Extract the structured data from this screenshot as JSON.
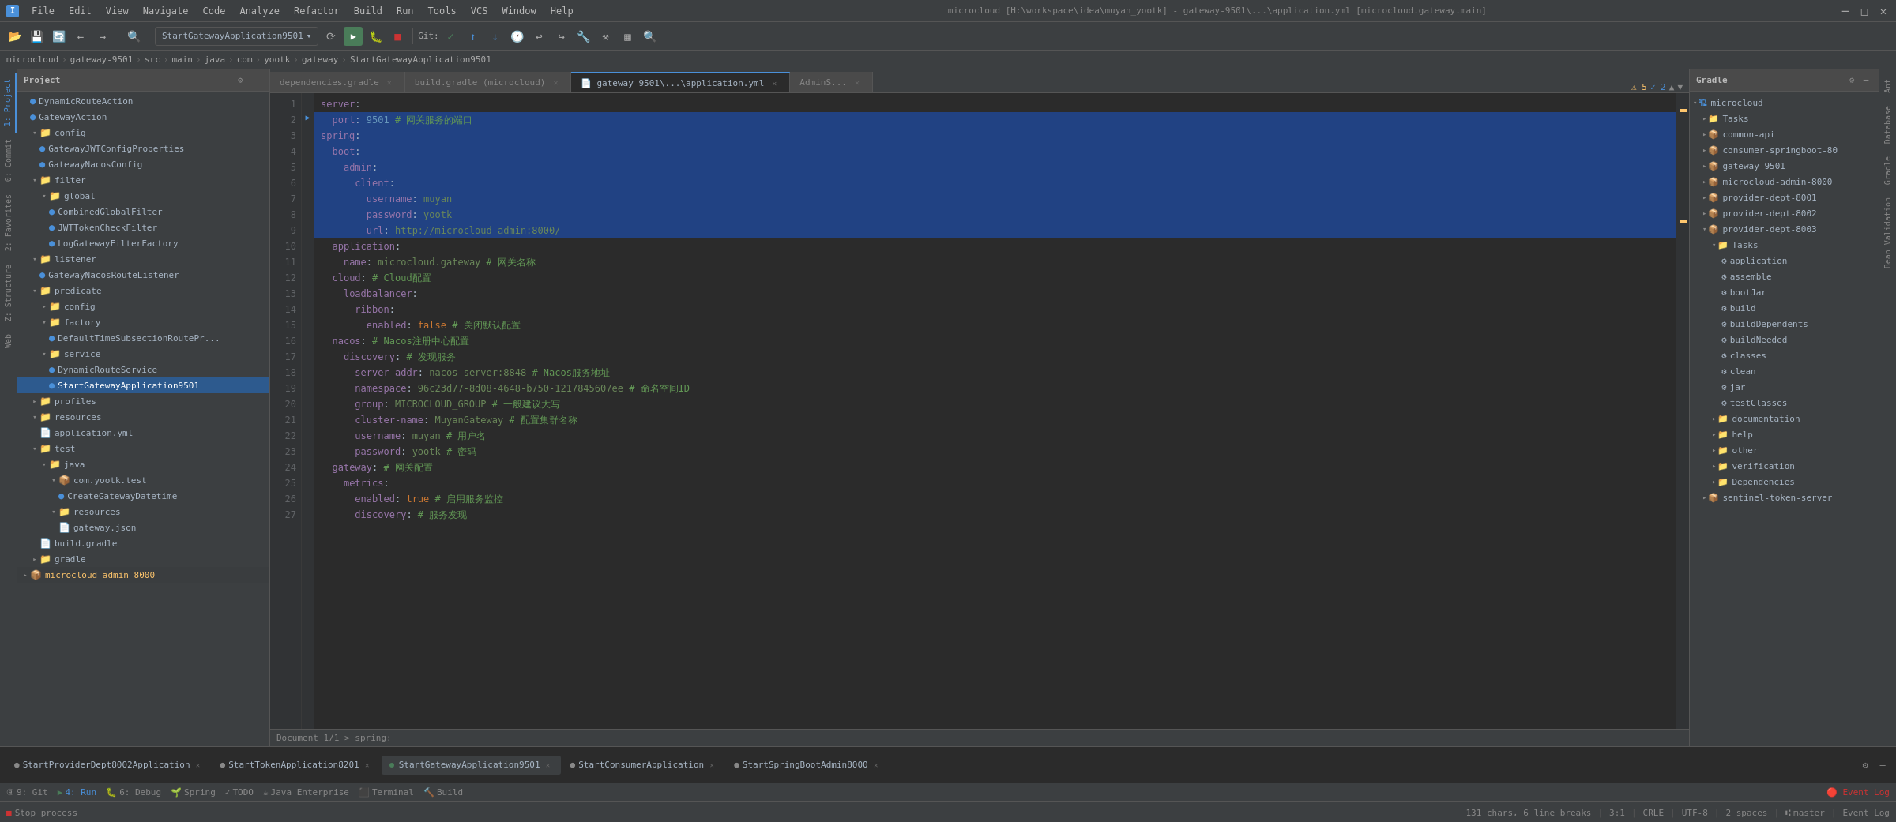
{
  "titleBar": {
    "title": "microcloud [H:\\workspace\\idea\\muyan_yootk] - gateway-9501\\...\\application.yml [microcloud.gateway.main]",
    "menus": [
      "File",
      "Edit",
      "View",
      "Navigate",
      "Code",
      "Analyze",
      "Refactor",
      "Build",
      "Run",
      "Tools",
      "VCS",
      "Window",
      "Help"
    ]
  },
  "toolbar": {
    "runConfig": "StartGatewayApplication9501",
    "gitLabel": "Git:"
  },
  "breadcrumb": {
    "items": [
      "microcloud",
      "gateway-9501",
      "src",
      "main",
      "java",
      "com",
      "yootk",
      "gateway",
      "StartGatewayApplication9501"
    ]
  },
  "editorTabs": [
    {
      "label": "dependencies.gradle",
      "active": false,
      "modified": false
    },
    {
      "label": "build.gradle (microcloud)",
      "active": false,
      "modified": false
    },
    {
      "label": "gateway-9501\\...\\application.yml",
      "active": true,
      "modified": false
    },
    {
      "label": "AdminS...",
      "active": false,
      "modified": false
    }
  ],
  "projectPanel": {
    "title": "Project",
    "items": [
      {
        "indent": 0,
        "type": "class",
        "label": "DynamicRouteAction",
        "color": "blue"
      },
      {
        "indent": 0,
        "type": "class",
        "label": "GatewayAction",
        "color": "blue"
      },
      {
        "indent": 0,
        "type": "folder",
        "label": "config",
        "expanded": true
      },
      {
        "indent": 1,
        "type": "class",
        "label": "GatewayJWTConfigProperties",
        "color": "blue"
      },
      {
        "indent": 1,
        "type": "class",
        "label": "GatewayNacosConfig",
        "color": "blue"
      },
      {
        "indent": 0,
        "type": "folder",
        "label": "filter",
        "expanded": true
      },
      {
        "indent": 1,
        "type": "folder",
        "label": "global",
        "expanded": true
      },
      {
        "indent": 2,
        "type": "class",
        "label": "CombinedGlobalFilter",
        "color": "blue"
      },
      {
        "indent": 2,
        "type": "class",
        "label": "JWTTokenCheckFilter",
        "color": "blue"
      },
      {
        "indent": 2,
        "type": "class",
        "label": "LogGatewayFilterFactory",
        "color": "blue"
      },
      {
        "indent": 0,
        "type": "folder",
        "label": "listener",
        "expanded": true
      },
      {
        "indent": 1,
        "type": "class",
        "label": "GatewayNacosRouteListener",
        "color": "blue"
      },
      {
        "indent": 0,
        "type": "folder",
        "label": "predicate",
        "expanded": true
      },
      {
        "indent": 1,
        "type": "folder",
        "label": "config",
        "expanded": false
      },
      {
        "indent": 1,
        "type": "folder",
        "label": "factory",
        "expanded": true
      },
      {
        "indent": 2,
        "type": "class",
        "label": "DefaultTimeSubsectionRoutePr...",
        "color": "blue"
      },
      {
        "indent": 1,
        "type": "folder",
        "label": "service",
        "expanded": true
      },
      {
        "indent": 2,
        "type": "class",
        "label": "DynamicRouteService",
        "color": "blue"
      },
      {
        "indent": 2,
        "type": "class",
        "label": "StartGatewayApplication9501",
        "color": "blue",
        "selected": true
      },
      {
        "indent": 0,
        "type": "folder",
        "label": "profiles",
        "expanded": false
      },
      {
        "indent": 0,
        "type": "folder",
        "label": "resources",
        "expanded": true
      },
      {
        "indent": 1,
        "type": "file",
        "label": "application.yml",
        "color": "yellow"
      },
      {
        "indent": 0,
        "type": "folder",
        "label": "test",
        "expanded": true
      },
      {
        "indent": 1,
        "type": "folder",
        "label": "java",
        "expanded": true
      },
      {
        "indent": 2,
        "type": "package",
        "label": "com.yootk.test",
        "expanded": true
      },
      {
        "indent": 3,
        "type": "class",
        "label": "CreateGatewayDatetime",
        "color": "blue"
      },
      {
        "indent": 2,
        "type": "folder",
        "label": "resources",
        "expanded": true
      },
      {
        "indent": 3,
        "type": "file",
        "label": "gateway.json",
        "color": "yellow"
      },
      {
        "indent": 1,
        "type": "file",
        "label": "build.gradle",
        "color": "green"
      },
      {
        "indent": 0,
        "type": "folder",
        "label": "gradle",
        "expanded": false
      },
      {
        "indent": 0,
        "type": "module",
        "label": "microcloud-admin-8000",
        "expanded": false
      }
    ]
  },
  "codeLines": [
    {
      "num": 1,
      "content": "server:",
      "highlight": false
    },
    {
      "num": 2,
      "content": "  port: 9501 # 网关服务的端口",
      "highlight": true
    },
    {
      "num": 3,
      "content": "spring:",
      "highlight": true
    },
    {
      "num": 4,
      "content": "  boot:",
      "highlight": true
    },
    {
      "num": 5,
      "content": "    admin:",
      "highlight": true
    },
    {
      "num": 6,
      "content": "      client:",
      "highlight": true
    },
    {
      "num": 7,
      "content": "        username: muyan",
      "highlight": true
    },
    {
      "num": 8,
      "content": "        password: yootk",
      "highlight": true
    },
    {
      "num": 9,
      "content": "        url: http://microcloud-admin:8000/",
      "highlight": true
    },
    {
      "num": 10,
      "content": "  application:",
      "highlight": false
    },
    {
      "num": 11,
      "content": "    name: microcloud.gateway # 网关名称",
      "highlight": false
    },
    {
      "num": 12,
      "content": "  cloud: # Cloud配置",
      "highlight": false
    },
    {
      "num": 13,
      "content": "    loadbalancer:",
      "highlight": false
    },
    {
      "num": 14,
      "content": "      ribbon:",
      "highlight": false
    },
    {
      "num": 15,
      "content": "        enabled: false # 关闭默认配置",
      "highlight": false
    },
    {
      "num": 16,
      "content": "  nacos: # Nacos注册中心配置",
      "highlight": false
    },
    {
      "num": 17,
      "content": "    discovery: # 发现服务",
      "highlight": false
    },
    {
      "num": 18,
      "content": "      server-addr: nacos-server:8848 # Nacos服务地址",
      "highlight": false
    },
    {
      "num": 19,
      "content": "      namespace: 96c23d77-8d08-4648-b750-1217845607ee # 命名空间ID",
      "highlight": false
    },
    {
      "num": 20,
      "content": "      group: MICROCLOUD_GROUP # 一般建议大写",
      "highlight": false
    },
    {
      "num": 21,
      "content": "      cluster-name: MuyanGateway # 配置集群名称",
      "highlight": false
    },
    {
      "num": 22,
      "content": "      username: muyan # 用户名",
      "highlight": false
    },
    {
      "num": 23,
      "content": "      password: yootk # 密码",
      "highlight": false
    },
    {
      "num": 24,
      "content": "  gateway: # 网关配置",
      "highlight": false
    },
    {
      "num": 25,
      "content": "    metrics:",
      "highlight": false
    },
    {
      "num": 26,
      "content": "      enabled: true # 启用服务监控",
      "highlight": false
    },
    {
      "num": 27,
      "content": "      discovery: # 服务发现",
      "highlight": false
    }
  ],
  "gradlePanel": {
    "title": "Gradle",
    "items": [
      {
        "indent": 0,
        "type": "project",
        "label": "microcloud",
        "expanded": true
      },
      {
        "indent": 1,
        "type": "folder",
        "label": "Tasks",
        "expanded": false
      },
      {
        "indent": 1,
        "type": "module",
        "label": "common-api",
        "expanded": false
      },
      {
        "indent": 1,
        "type": "module",
        "label": "consumer-springboot-80",
        "expanded": false
      },
      {
        "indent": 1,
        "type": "module",
        "label": "gateway-9501",
        "expanded": true
      },
      {
        "indent": 1,
        "type": "module",
        "label": "microcloud-admin-8000",
        "expanded": false
      },
      {
        "indent": 1,
        "type": "module",
        "label": "provider-dept-8001",
        "expanded": false
      },
      {
        "indent": 1,
        "type": "module",
        "label": "provider-dept-8002",
        "expanded": false
      },
      {
        "indent": 1,
        "type": "module",
        "label": "provider-dept-8003",
        "expanded": true
      },
      {
        "indent": 2,
        "type": "folder",
        "label": "Tasks",
        "expanded": true
      },
      {
        "indent": 3,
        "type": "task",
        "label": "application"
      },
      {
        "indent": 3,
        "type": "task",
        "label": "assemble"
      },
      {
        "indent": 3,
        "type": "task",
        "label": "bootJar"
      },
      {
        "indent": 3,
        "type": "task",
        "label": "build"
      },
      {
        "indent": 3,
        "type": "task",
        "label": "buildDependents"
      },
      {
        "indent": 3,
        "type": "task",
        "label": "buildNeeded"
      },
      {
        "indent": 3,
        "type": "task",
        "label": "classes"
      },
      {
        "indent": 3,
        "type": "task",
        "label": "clean"
      },
      {
        "indent": 3,
        "type": "task",
        "label": "jar"
      },
      {
        "indent": 3,
        "type": "task",
        "label": "testClasses"
      },
      {
        "indent": 2,
        "type": "folder",
        "label": "documentation",
        "expanded": false
      },
      {
        "indent": 2,
        "type": "folder",
        "label": "help",
        "expanded": false
      },
      {
        "indent": 2,
        "type": "folder",
        "label": "other",
        "expanded": false
      },
      {
        "indent": 2,
        "type": "folder",
        "label": "verification",
        "expanded": false
      },
      {
        "indent": 2,
        "type": "folder",
        "label": "Dependencies",
        "expanded": false
      },
      {
        "indent": 1,
        "type": "module",
        "label": "sentinel-token-server",
        "expanded": false
      }
    ]
  },
  "runBar": {
    "tabs": [
      {
        "label": "StartProviderDept8002Application",
        "active": false
      },
      {
        "label": "StartTokenApplication8201",
        "active": false
      },
      {
        "label": "StartGatewayApplication9501",
        "active": true
      },
      {
        "label": "StartConsumerApplication",
        "active": false
      },
      {
        "label": "StartSpringBootAdmin8000",
        "active": false
      }
    ]
  },
  "bottomActionBar": {
    "items": [
      {
        "icon": "git",
        "label": "9: Git"
      },
      {
        "icon": "run",
        "label": "4: Run",
        "active": true
      },
      {
        "icon": "debug",
        "label": "6: Debug"
      },
      {
        "icon": "spring",
        "label": "Spring"
      },
      {
        "icon": "todo",
        "label": "TODO"
      },
      {
        "icon": "java",
        "label": "Java Enterprise"
      },
      {
        "icon": "terminal",
        "label": "Terminal"
      },
      {
        "icon": "build",
        "label": "Build"
      }
    ]
  },
  "statusBar": {
    "lineInfo": "131 chars, 6 line breaks",
    "position": "3:1",
    "encoding": "CRLE",
    "charSet": "UTF-8",
    "spaces": "2 spaces",
    "branch": "master",
    "eventLog": "Event Log"
  },
  "documentInfo": "Document 1/1 > spring:"
}
